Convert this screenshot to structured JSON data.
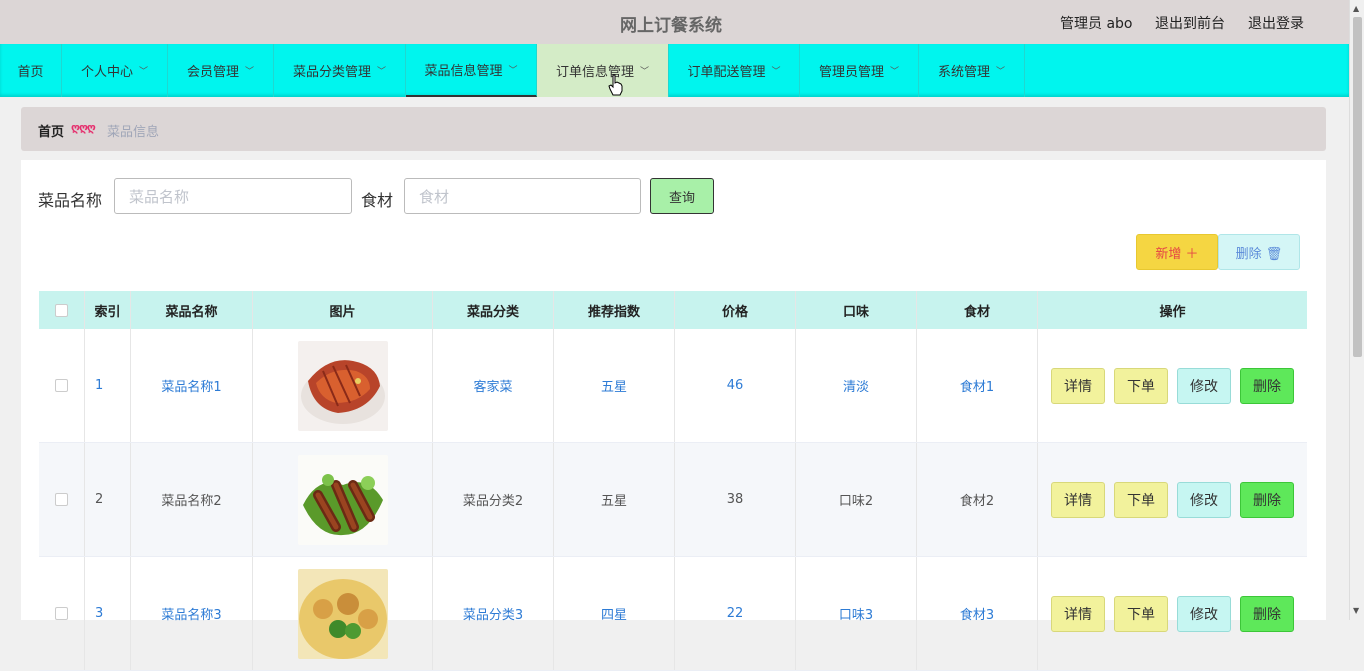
{
  "header": {
    "site_title": "网上订餐系统",
    "admin_label": "管理员 abo",
    "exit_front": "退出到前台",
    "logout": "退出登录"
  },
  "nav": {
    "items": [
      {
        "label": "首页",
        "has_chevron": false
      },
      {
        "label": "个人中心",
        "has_chevron": true
      },
      {
        "label": "会员管理",
        "has_chevron": true
      },
      {
        "label": "菜品分类管理",
        "has_chevron": true
      },
      {
        "label": "菜品信息管理",
        "has_chevron": true,
        "active": true
      },
      {
        "label": "订单信息管理",
        "has_chevron": true,
        "hovered": true
      },
      {
        "label": "订单配送管理",
        "has_chevron": true
      },
      {
        "label": "管理员管理",
        "has_chevron": true
      },
      {
        "label": "系统管理",
        "has_chevron": true
      }
    ]
  },
  "breadcrumb": {
    "home": "首页",
    "separator": "ღღღ",
    "current": "菜品信息"
  },
  "search": {
    "name_label": "菜品名称",
    "name_placeholder": "菜品名称",
    "ingredient_label": "食材",
    "ingredient_placeholder": "食材",
    "query_button": "查询"
  },
  "actions": {
    "add_button": "新增 ＋",
    "delete_button": "删除 🗑"
  },
  "table": {
    "headers": [
      "索引",
      "菜品名称",
      "图片",
      "菜品分类",
      "推荐指数",
      "价格",
      "口味",
      "食材",
      "操作"
    ],
    "rows": [
      {
        "index": "1",
        "name": "菜品名称1",
        "category": "客家菜",
        "rating": "五星",
        "price": "46",
        "taste": "清淡",
        "ingredient": "食材1"
      },
      {
        "index": "2",
        "name": "菜品名称2",
        "category": "菜品分类2",
        "rating": "五星",
        "price": "38",
        "taste": "口味2",
        "ingredient": "食材2"
      },
      {
        "index": "3",
        "name": "菜品名称3",
        "category": "菜品分类3",
        "rating": "四星",
        "price": "22",
        "taste": "口味3",
        "ingredient": "食材3"
      }
    ],
    "op_labels": {
      "detail": "详情",
      "order": "下单",
      "edit": "修改",
      "delete": "删除"
    }
  },
  "colors": {
    "nav_bg": "#00f5ee",
    "header_bg": "#dcd6d6",
    "table_header_bg": "#c7f3ee",
    "link_blue": "#2d7bd5"
  }
}
